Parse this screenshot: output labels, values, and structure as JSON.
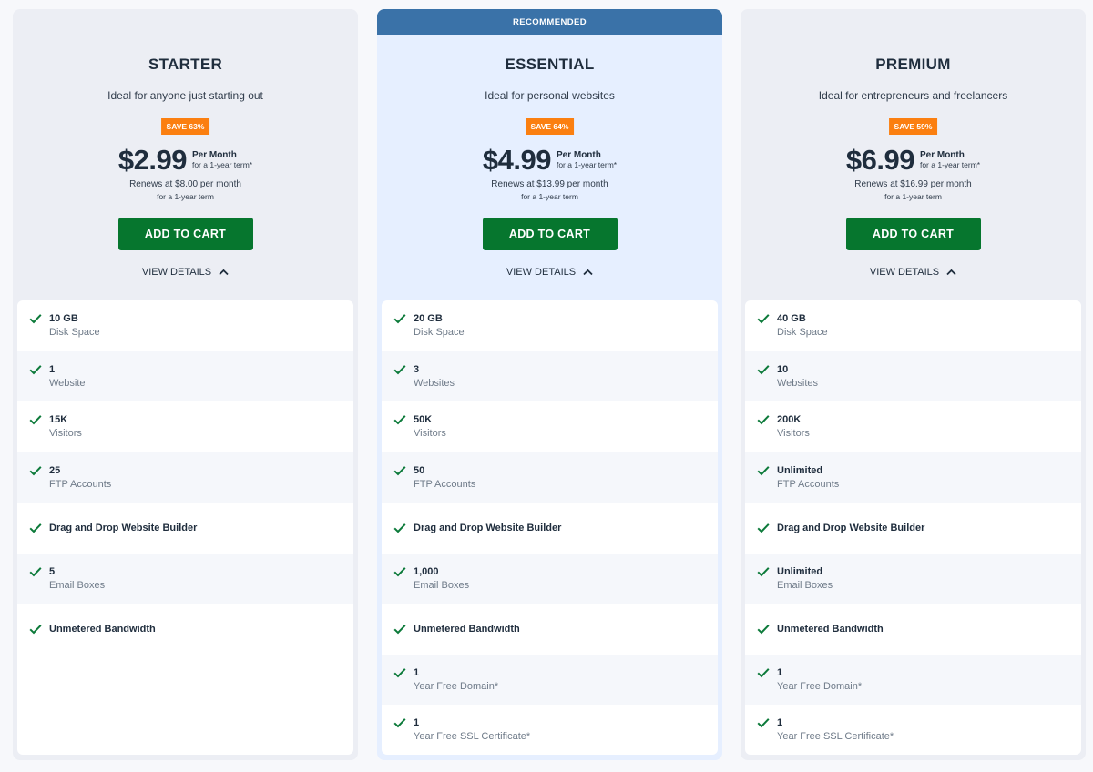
{
  "plans": [
    {
      "recommended_label": "",
      "title": "STARTER",
      "subtitle": "Ideal for anyone just starting out",
      "save_badge": "SAVE 63%",
      "price": "$2.99",
      "per_label": "Per Month",
      "term_label": "for a 1-year term*",
      "renew_text": "Renews at $8.00 per month",
      "renew_term": "for a 1-year term",
      "cart_label": "ADD TO CART",
      "details_label": "VIEW DETAILS",
      "features": [
        {
          "value": "10 GB",
          "label": "Disk Space"
        },
        {
          "value": "1",
          "label": "Website"
        },
        {
          "value": "15K",
          "label": "Visitors"
        },
        {
          "value": "25",
          "label": "FTP Accounts"
        },
        {
          "value": "Drag and Drop Website Builder",
          "label": ""
        },
        {
          "value": "5",
          "label": "Email Boxes"
        },
        {
          "value": "Unmetered Bandwidth",
          "label": ""
        }
      ]
    },
    {
      "recommended_label": "RECOMMENDED",
      "title": "ESSENTIAL",
      "subtitle": "Ideal for personal websites",
      "save_badge": "SAVE 64%",
      "price": "$4.99",
      "per_label": "Per Month",
      "term_label": "for a 1-year term*",
      "renew_text": "Renews at $13.99 per month",
      "renew_term": "for a 1-year term",
      "cart_label": "ADD TO CART",
      "details_label": "VIEW DETAILS",
      "features": [
        {
          "value": "20 GB",
          "label": "Disk Space"
        },
        {
          "value": "3",
          "label": "Websites"
        },
        {
          "value": "50K",
          "label": "Visitors"
        },
        {
          "value": "50",
          "label": "FTP Accounts"
        },
        {
          "value": "Drag and Drop Website Builder",
          "label": ""
        },
        {
          "value": "1,000",
          "label": "Email Boxes"
        },
        {
          "value": "Unmetered Bandwidth",
          "label": ""
        },
        {
          "value": "1",
          "label": "Year Free Domain*"
        },
        {
          "value": "1",
          "label": "Year Free SSL Certificate*"
        }
      ]
    },
    {
      "recommended_label": "",
      "title": "PREMIUM",
      "subtitle": "Ideal for entrepreneurs and freelancers",
      "save_badge": "SAVE 59%",
      "price": "$6.99",
      "per_label": "Per Month",
      "term_label": "for a 1-year term*",
      "renew_text": "Renews at $16.99 per month",
      "renew_term": "for a 1-year term",
      "cart_label": "ADD TO CART",
      "details_label": "VIEW DETAILS",
      "features": [
        {
          "value": "40 GB",
          "label": "Disk Space"
        },
        {
          "value": "10",
          "label": "Websites"
        },
        {
          "value": "200K",
          "label": "Visitors"
        },
        {
          "value": "Unlimited",
          "label": "FTP Accounts"
        },
        {
          "value": "Drag and Drop Website Builder",
          "label": ""
        },
        {
          "value": "Unlimited",
          "label": "Email Boxes"
        },
        {
          "value": "Unmetered Bandwidth",
          "label": ""
        },
        {
          "value": "1",
          "label": "Year Free Domain*"
        },
        {
          "value": "1",
          "label": "Year Free SSL Certificate*"
        }
      ]
    }
  ],
  "colors": {
    "card_bg": "#eceef4",
    "recommended_bg": "#e6efff",
    "ribbon": "#3a72a8",
    "save_badge": "#fb7f10",
    "cart_button": "#06762e",
    "check": "#0c7a3a",
    "text_dark": "#1f2d3d",
    "text_muted": "#6f7b89"
  },
  "icons": {
    "check": "check-icon",
    "chevron": "chevron-up-icon"
  }
}
